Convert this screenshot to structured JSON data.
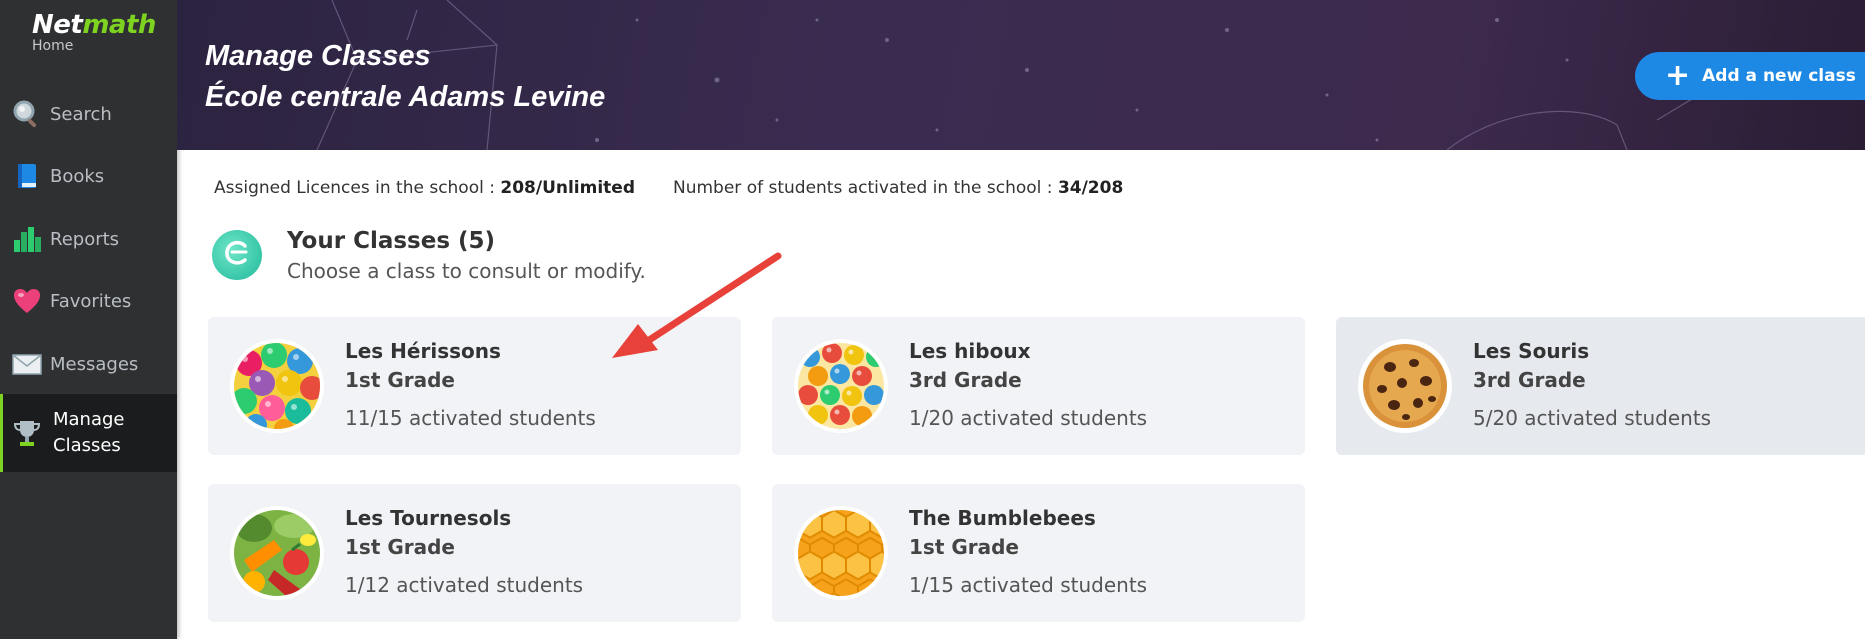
{
  "sidebar": {
    "logo_main": "Net",
    "logo_accent": "math",
    "logo_home": "Home",
    "items": [
      {
        "label": "Search",
        "icon": "search-icon"
      },
      {
        "label": "Books",
        "icon": "book-icon"
      },
      {
        "label": "Reports",
        "icon": "bar-chart-icon"
      },
      {
        "label": "Favorites",
        "icon": "heart-icon"
      },
      {
        "label": "Messages",
        "icon": "envelope-icon"
      },
      {
        "label": "Manage Classes",
        "icon": "trophy-icon",
        "active": true
      }
    ]
  },
  "header": {
    "title_line1": "Manage Classes",
    "title_line2": "École centrale Adams Levine",
    "add_class_label": "Add a new class"
  },
  "stats": {
    "licences_label": "Assigned Licences in the school :",
    "licences_value": "208/Unlimited",
    "students_label": "Number of students activated in the school :",
    "students_value": "34/208"
  },
  "classes": {
    "title": "Your Classes (5)",
    "subtitle": "Choose a class to consult or modify.",
    "cards": [
      {
        "name": "Les Hérissons",
        "grade": "1st Grade",
        "count": "11/15 activated students",
        "thumb": "gumballs"
      },
      {
        "name": "Les hiboux",
        "grade": "3rd Grade",
        "count": "1/20 activated students",
        "thumb": "balls"
      },
      {
        "name": "Les Souris",
        "grade": "3rd Grade",
        "count": "5/20 activated students",
        "thumb": "cookie"
      },
      {
        "name": "Les Tournesols",
        "grade": "1st Grade",
        "count": "1/12 activated students",
        "thumb": "vegetables"
      },
      {
        "name": "The Bumblebees",
        "grade": "1st Grade",
        "count": "1/15 activated students",
        "thumb": "honeycomb"
      }
    ]
  },
  "colors": {
    "sidebar_bg": "#2f3032",
    "accent_green": "#7ed321",
    "button_blue": "#1e88e5",
    "card_bg": "#f1f3f6",
    "arrow_red": "#e8413a"
  }
}
